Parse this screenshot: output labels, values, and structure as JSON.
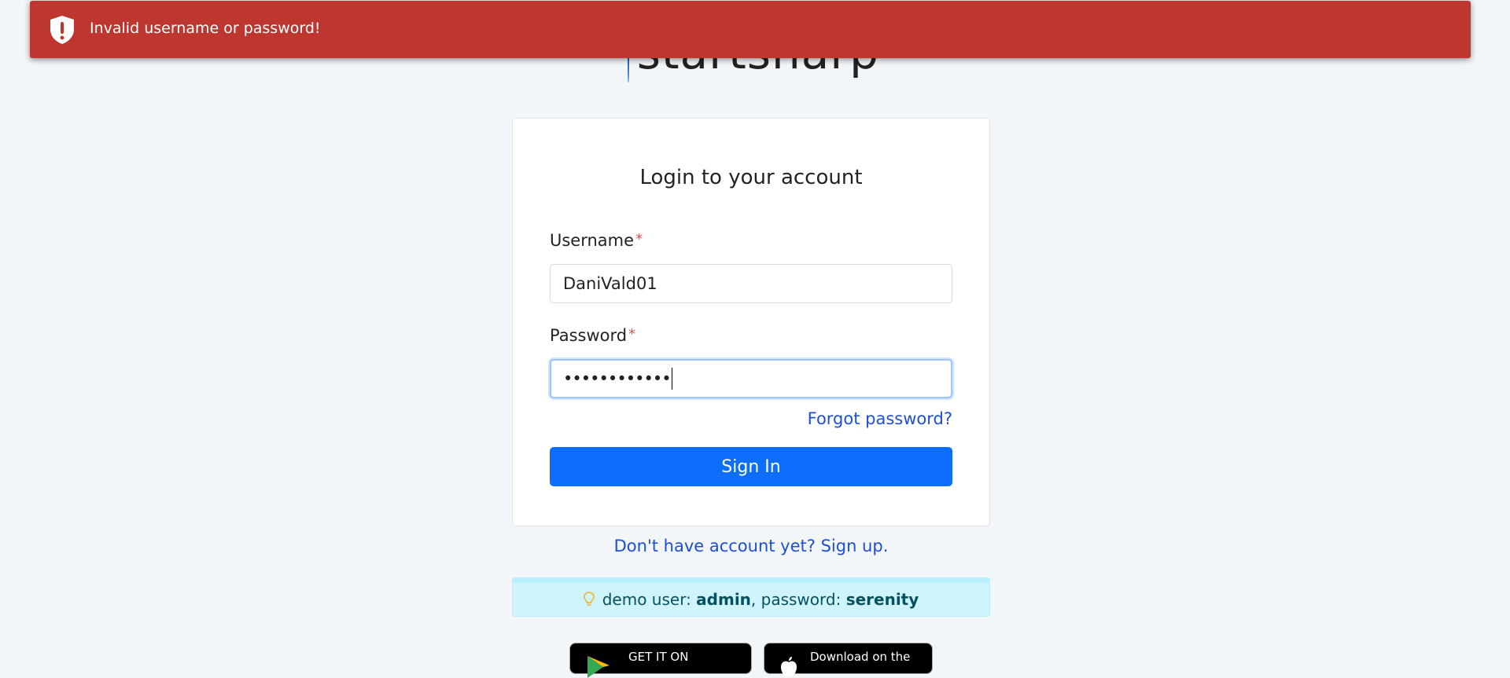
{
  "toast": {
    "message": "Invalid username or password!",
    "icon": "shield-exclamation-icon",
    "color": "#bd362f"
  },
  "logo": {
    "text": "startsharp"
  },
  "login": {
    "title": "Login to your account",
    "username_label": "Username",
    "username_value": "DaniVald01",
    "password_label": "Password",
    "password_value": "••••••••••••",
    "required_marker": "*",
    "forgot_link": "Forgot password?",
    "signin_button": "Sign In"
  },
  "signup_link": "Don't have account yet? Sign up.",
  "demo": {
    "prefix": "demo user: ",
    "user": "admin",
    "mid": ", password: ",
    "password": "serenity",
    "icon": "lightbulb-icon"
  },
  "stores": {
    "google_label": "GET IT ON",
    "apple_label": "Download on the"
  },
  "colors": {
    "primary": "#0d6efd",
    "link": "#1d4ed8",
    "error": "#bd362f",
    "info_bg": "#cff4fc"
  }
}
